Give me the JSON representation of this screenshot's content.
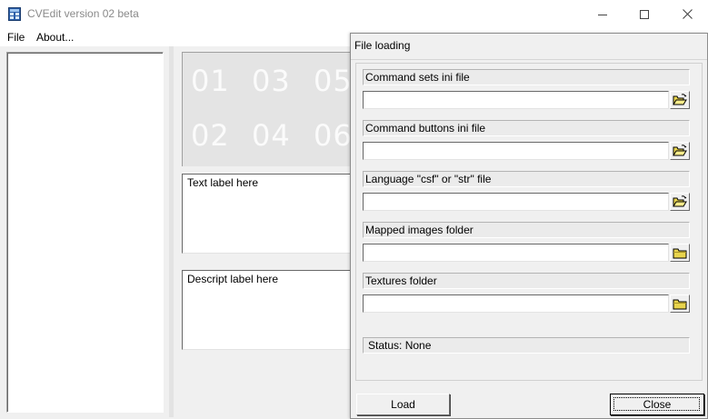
{
  "window": {
    "title": "CVEdit version 02 beta",
    "icons": {
      "app": "cvedit-app-icon",
      "minimize": "minimize-icon",
      "maximize": "maximize-icon",
      "close": "close-icon"
    }
  },
  "menu": {
    "file": "File",
    "about": "About..."
  },
  "preview": {
    "numbers": [
      "01",
      "03",
      "05",
      "02",
      "04",
      "06"
    ]
  },
  "labels": {
    "text": "Text label here",
    "descript": "Descript label here"
  },
  "dialog": {
    "title": "File loading",
    "fields": [
      {
        "caption": "Command sets ini file",
        "value": "",
        "icon": "open-folder-icon"
      },
      {
        "caption": "Command buttons ini file",
        "value": "",
        "icon": "open-folder-icon"
      },
      {
        "caption": "Language \"csf\" or \"str\" file",
        "value": "",
        "icon": "open-folder-icon"
      },
      {
        "caption": "Mapped images folder",
        "value": "",
        "icon": "folder-icon"
      },
      {
        "caption": "Textures folder",
        "value": "",
        "icon": "folder-icon"
      }
    ],
    "status": "Status:  None",
    "load_label": "Load",
    "close_label": "Close"
  }
}
